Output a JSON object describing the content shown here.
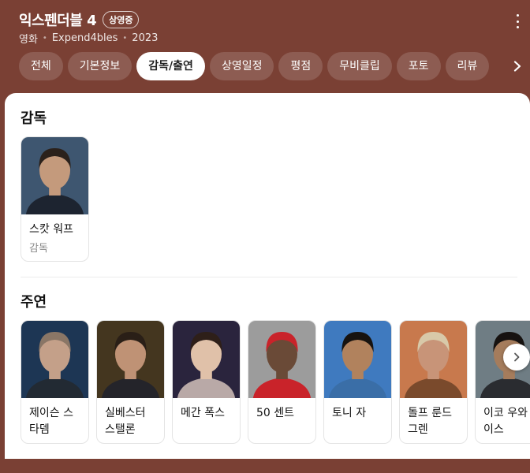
{
  "movie": {
    "title": "익스펜더블 4",
    "status_badge": "상영중",
    "type": "영화",
    "original_title": "Expend4bles",
    "year": "2023"
  },
  "tabs": [
    {
      "label": "전체",
      "active": false
    },
    {
      "label": "기본정보",
      "active": false
    },
    {
      "label": "감독/출연",
      "active": true
    },
    {
      "label": "상영일정",
      "active": false
    },
    {
      "label": "평점",
      "active": false
    },
    {
      "label": "무비클립",
      "active": false
    },
    {
      "label": "포토",
      "active": false
    },
    {
      "label": "리뷰",
      "active": false
    }
  ],
  "director_section": {
    "title": "감독",
    "people": [
      {
        "name": "스캇 워프",
        "role": "감독",
        "photo_colors": {
          "bg": "#3e5670",
          "skin": "#c49a7c",
          "hair": "#2b211b",
          "shirt": "#1d2430"
        }
      }
    ]
  },
  "cast_section": {
    "title": "주연",
    "people": [
      {
        "name": "제이슨 스타뎀",
        "photo_colors": {
          "bg": "#1d3654",
          "skin": "#c4a089",
          "hair": "#8a7666",
          "shirt": "#222a33"
        }
      },
      {
        "name": "실베스터 스탤론",
        "photo_colors": {
          "bg": "#44361f",
          "skin": "#bf9275",
          "hair": "#2a1f17",
          "shirt": "#24242a"
        }
      },
      {
        "name": "메간 폭스",
        "photo_colors": {
          "bg": "#2a243d",
          "skin": "#e0c1a9",
          "hair": "#2e1f19",
          "shirt": "#b9a9a7"
        }
      },
      {
        "name": "50 센트",
        "photo_colors": {
          "bg": "#9c9c9c",
          "skin": "#6a4a37",
          "hair": "#c9232a",
          "shirt": "#c9232a"
        }
      },
      {
        "name": "토니 자",
        "photo_colors": {
          "bg": "#3f7abf",
          "skin": "#b1825d",
          "hair": "#171310",
          "shirt": "#3a6ea7"
        }
      },
      {
        "name": "돌프 룬드그렌",
        "photo_colors": {
          "bg": "#c8794d",
          "skin": "#c89478",
          "hair": "#d8c9a9",
          "shirt": "#7a4a2c"
        }
      },
      {
        "name": "이코 우와이스",
        "photo_colors": {
          "bg": "#6f7d84",
          "skin": "#a57c5c",
          "hair": "#161210",
          "shirt": "#2a2c30"
        }
      }
    ]
  }
}
